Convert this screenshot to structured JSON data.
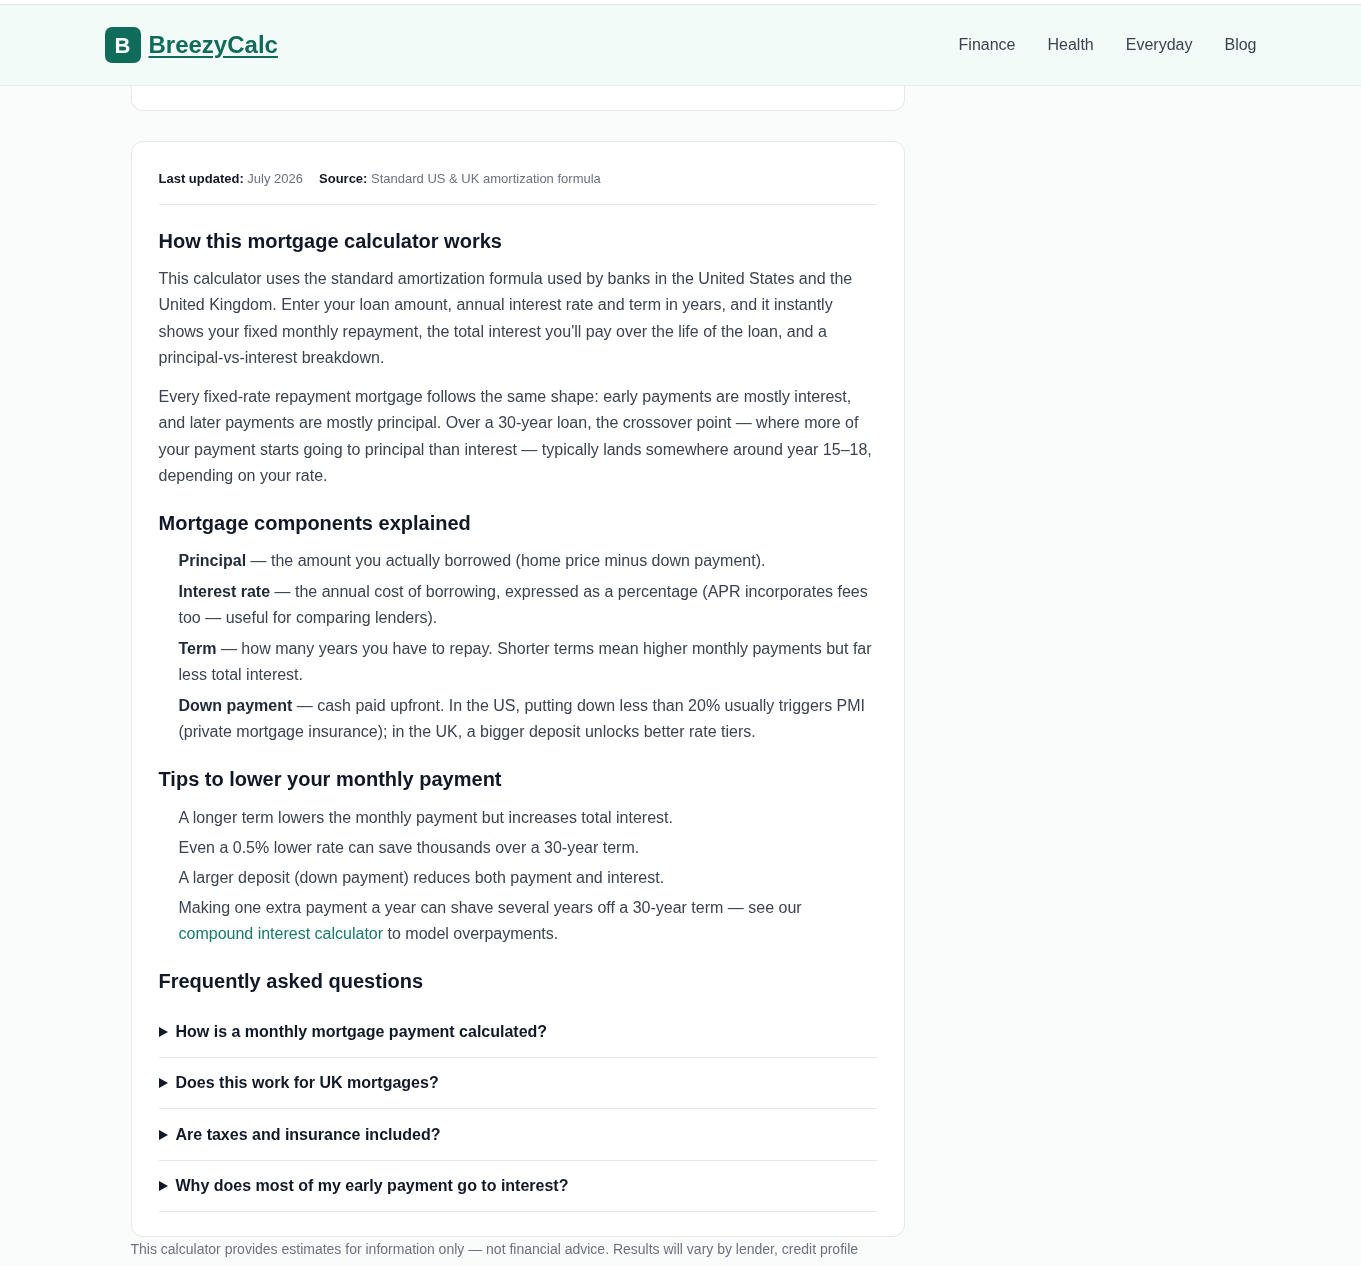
{
  "header": {
    "logo_letter": "B",
    "brand": "BreezyCalc",
    "nav": [
      "Finance",
      "Health",
      "Everyday",
      "Blog"
    ]
  },
  "article": {
    "meta": [
      {
        "label": "Last updated:",
        "value": "July 2026"
      },
      {
        "label": "Source:",
        "value": "Standard US & UK amortization formula"
      }
    ],
    "sections": [
      {
        "kind": "paragraphs",
        "heading": "How this mortgage calculator works",
        "paragraphs": [
          "This calculator uses the standard amortization formula used by banks in the United States and the United Kingdom. Enter your loan amount, annual interest rate and term in years, and it instantly shows your fixed monthly repayment, the total interest you'll pay over the life of the loan, and a principal-vs-interest breakdown.",
          "Every fixed-rate repayment mortgage follows the same shape: early payments are mostly interest, and later payments are mostly principal. Over a 30-year loan, the crossover point — where more of your payment starts going to principal than interest — typically lands somewhere around year 15–18, depending on your rate."
        ]
      },
      {
        "kind": "definitions",
        "heading": "Mortgage components explained",
        "items": [
          "**Principal** — the amount you actually borrowed (home price minus down payment).",
          "**Interest rate** — the annual cost of borrowing, expressed as a percentage (APR incorporates fees too — useful for comparing lenders).",
          "**Term** — how many years you have to repay. Shorter terms mean higher monthly payments but far less total interest.",
          "**Down payment** — cash paid upfront. In the US, putting down less than 20% usually triggers PMI (private mortgage insurance); in the UK, a bigger deposit unlocks better rate tiers."
        ]
      },
      {
        "kind": "tips",
        "heading": "Tips to lower your monthly payment",
        "items": [
          {
            "text": "A longer term lowers the monthly payment but increases total interest."
          },
          {
            "text": "Even a 0.5% lower rate can save thousands over a 30-year term."
          },
          {
            "text": "A larger deposit (down payment) reduces both payment and interest."
          },
          {
            "text": "Making one extra payment a year can shave several years off a 30-year term — see our",
            "link": "compound interest calculator",
            "after": "to model overpayments."
          }
        ]
      },
      {
        "kind": "faq",
        "heading": "Frequently asked questions",
        "items": [
          {
            "question": "How is a monthly mortgage payment calculated?",
            "expanded": false
          },
          {
            "question": "Does this work for UK mortgages?",
            "expanded": false
          },
          {
            "question": "Are taxes and insurance included?",
            "expanded": false
          },
          {
            "question": "Why does most of my early payment go to interest?",
            "expanded": false
          }
        ]
      }
    ]
  },
  "disclaimer": "This calculator provides estimates for information only — not financial advice. Results will vary by lender, credit profile"
}
